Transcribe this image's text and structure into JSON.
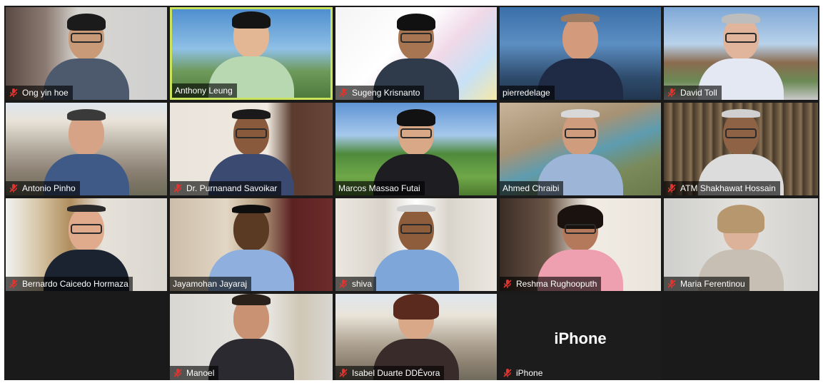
{
  "participants": [
    {
      "name": "Ong yin hoe",
      "muted": true
    },
    {
      "name": "Anthony Leung",
      "muted": false,
      "active_speaker": true
    },
    {
      "name": "Sugeng Krisnanto",
      "muted": true
    },
    {
      "name": "pierredelage",
      "muted": false
    },
    {
      "name": "David Toll",
      "muted": true
    },
    {
      "name": "Antonio Pinho",
      "muted": true
    },
    {
      "name": "Dr. Purnanand Savoikar",
      "muted": true
    },
    {
      "name": "Marcos Massao Futai",
      "muted": false
    },
    {
      "name": "Ahmed Chraibi",
      "muted": false
    },
    {
      "name": "ATM Shakhawat Hossain",
      "muted": true
    },
    {
      "name": "Bernardo Caicedo Hormaza",
      "muted": true
    },
    {
      "name": "Jayamohan Jayaraj",
      "muted": false
    },
    {
      "name": "shiva",
      "muted": true
    },
    {
      "name": "Reshma Rughooputh",
      "muted": true
    },
    {
      "name": "Maria Ferentinou",
      "muted": true
    },
    {
      "name": "Manoel",
      "muted": true
    },
    {
      "name": "Isabel Duarte DDÉvora",
      "muted": true
    },
    {
      "name": "iPhone",
      "muted": true,
      "video_off": true,
      "center_label": "iPhone"
    }
  ],
  "colors": {
    "active_border": "#c9e35a",
    "mute_red": "#e0342f",
    "background": "#1a1a1a"
  },
  "icons": {
    "mute": "microphone-muted-icon"
  }
}
